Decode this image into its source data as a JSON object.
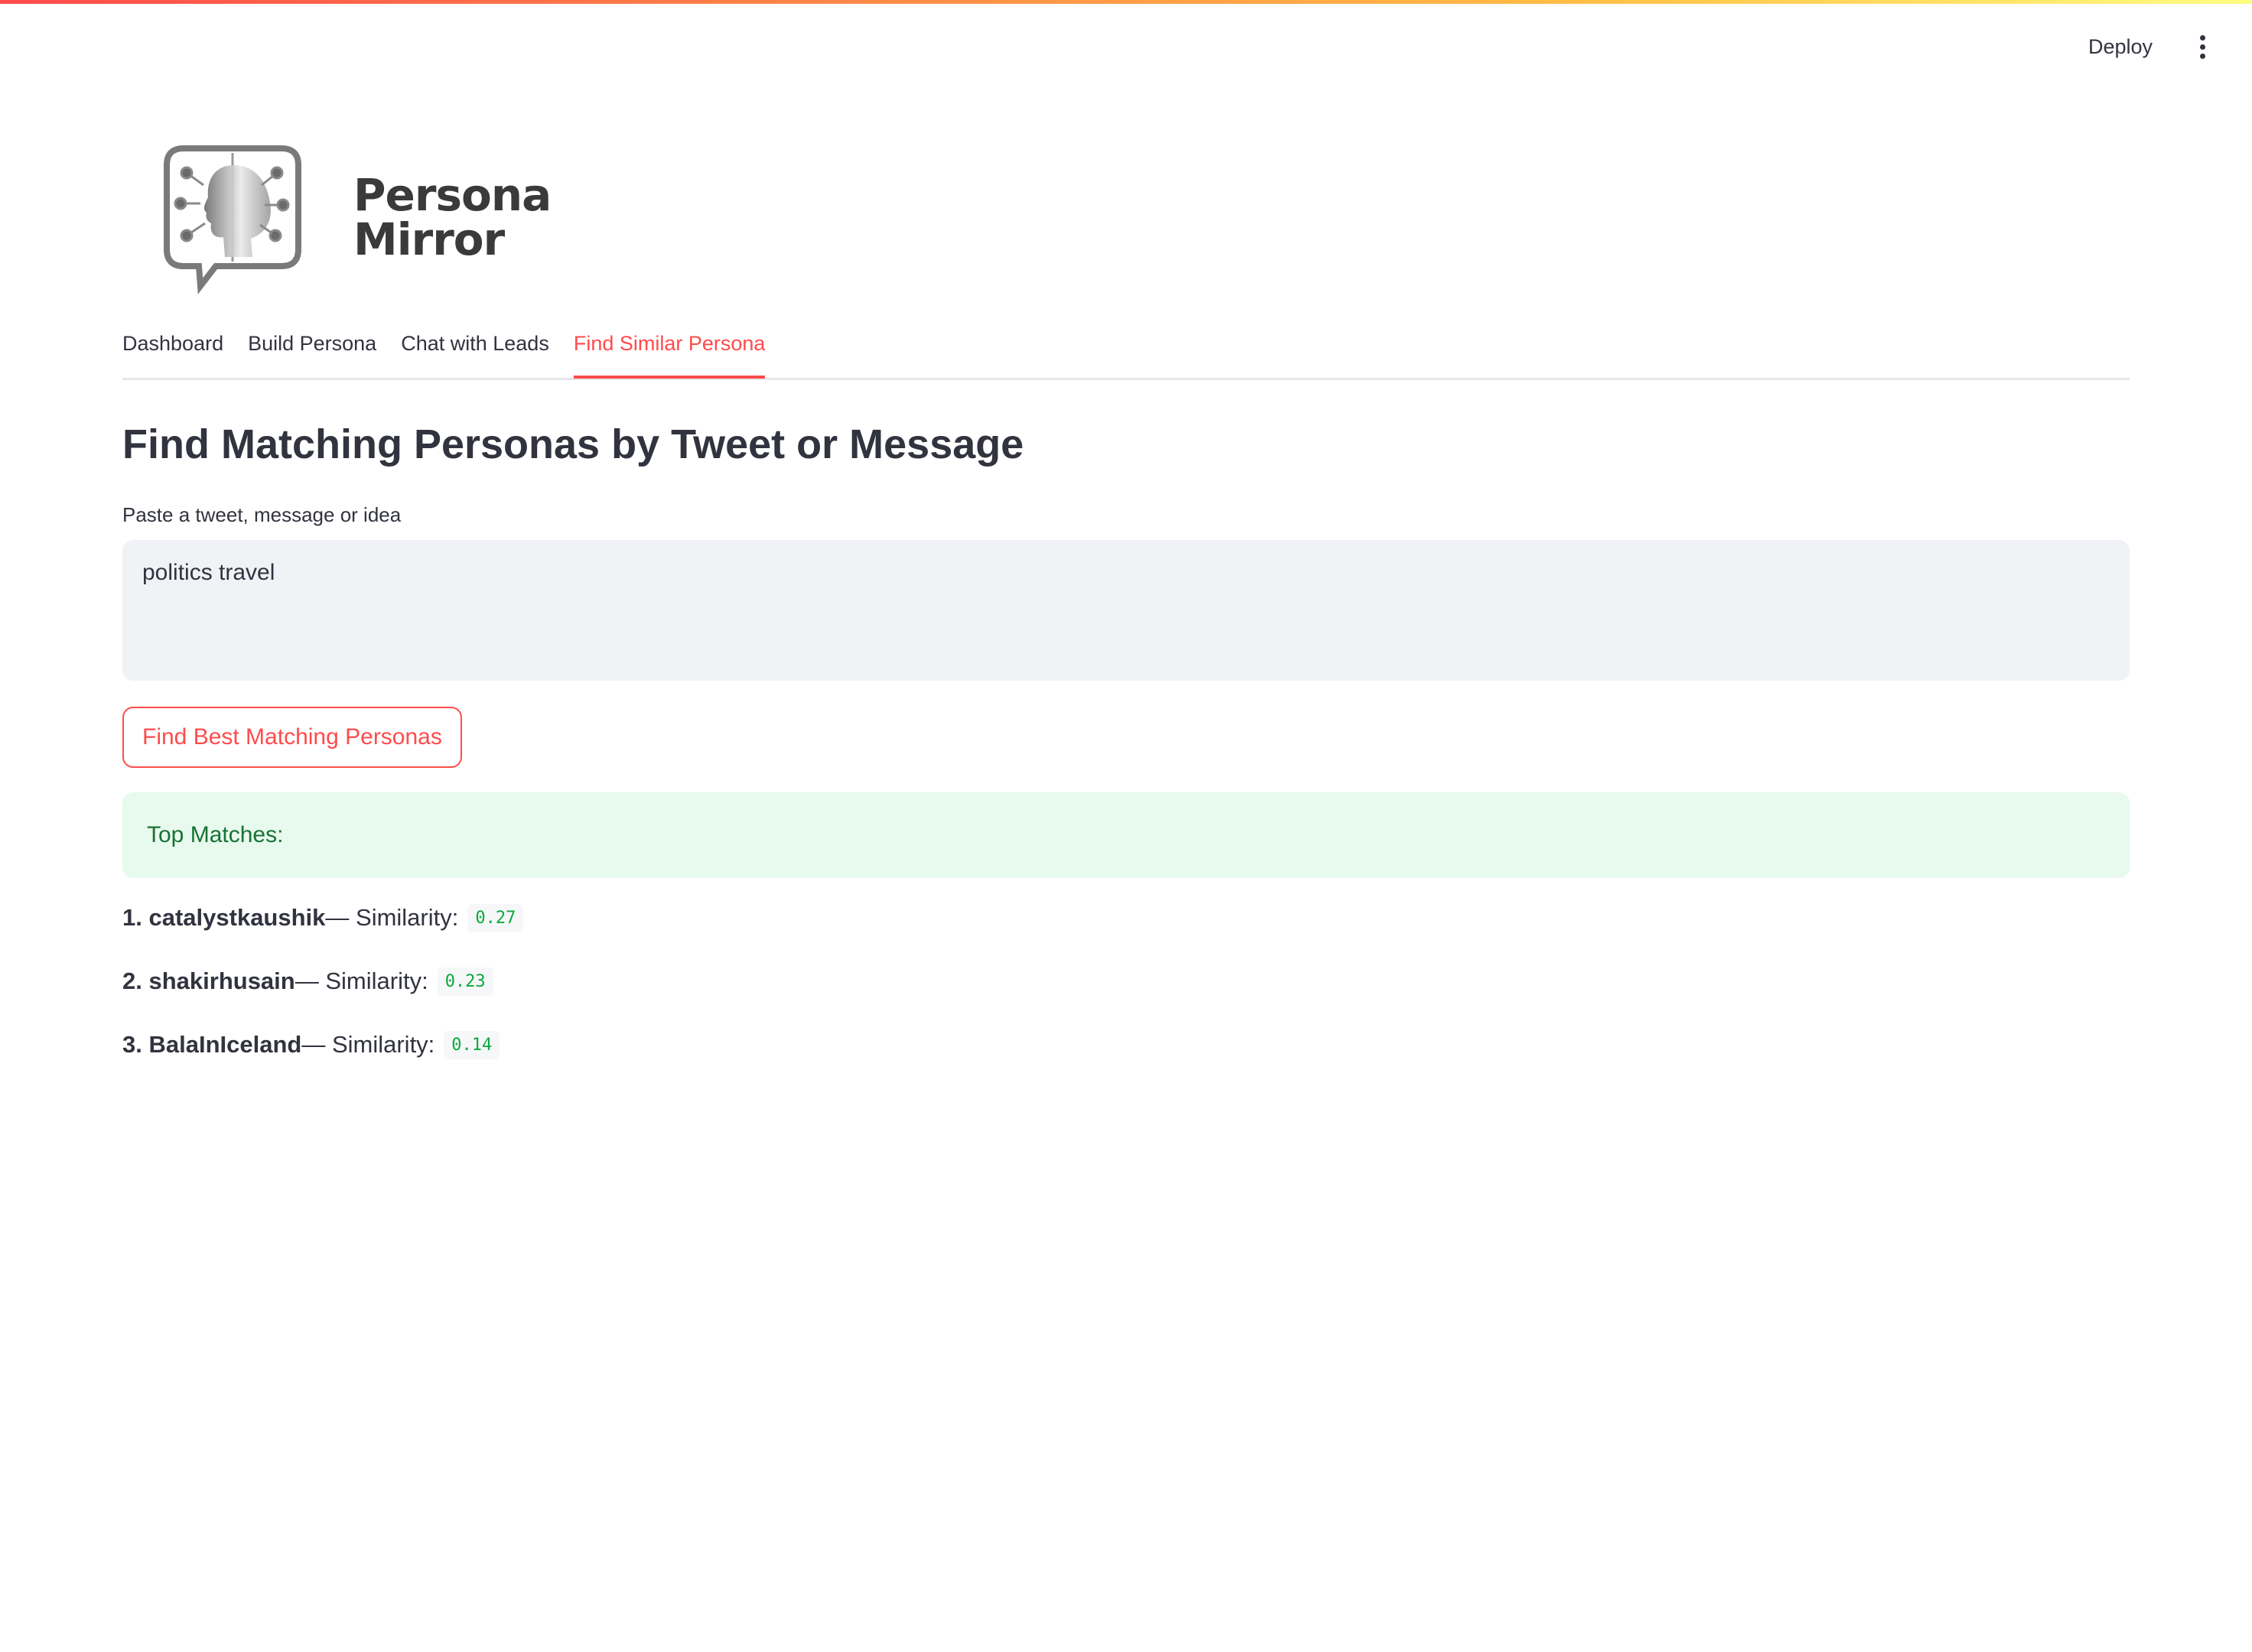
{
  "header": {
    "deploy_label": "Deploy",
    "menu_icon": "vertical-dots-icon"
  },
  "logo": {
    "line1": "Persona",
    "line2": "Mirror",
    "icon": "persona-head-chat-icon"
  },
  "tabs": [
    {
      "label": "Dashboard",
      "active": false
    },
    {
      "label": "Build Persona",
      "active": false
    },
    {
      "label": "Chat with Leads",
      "active": false
    },
    {
      "label": "Find Similar Persona",
      "active": true
    }
  ],
  "main": {
    "title": "Find Matching Personas by Tweet or Message",
    "input_label": "Paste a tweet, message or idea",
    "input_value": "politics travel",
    "button_label": "Find Best Matching Personas",
    "success_text": "Top Matches:",
    "similarity_label": "— Similarity:",
    "matches": [
      {
        "rank": "1.",
        "name": "catalystkaushik",
        "score": "0.27"
      },
      {
        "rank": "2.",
        "name": "shakirhusain",
        "score": "0.23"
      },
      {
        "rank": "3.",
        "name": "BalaInIceland",
        "score": "0.14"
      }
    ]
  },
  "colors": {
    "accent": "#ff4b4b",
    "success_bg": "#e8f9ee",
    "success_text": "#177233",
    "code_text": "#09ab3b"
  }
}
